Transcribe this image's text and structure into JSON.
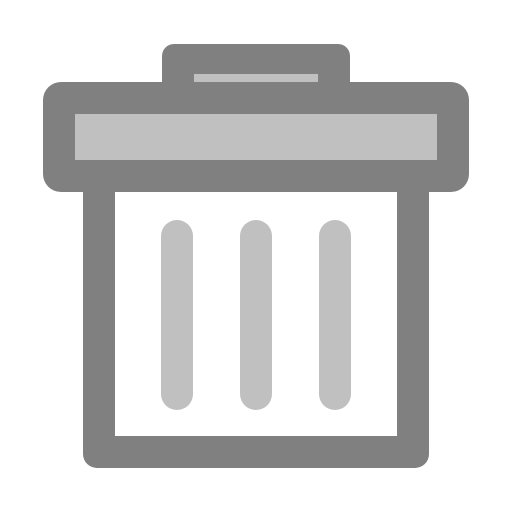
{
  "icon": {
    "name": "trash-can-icon",
    "colors": {
      "outline": "#808080",
      "fill_light": "#c0c0c0",
      "body_fill": "#ffffff"
    }
  }
}
